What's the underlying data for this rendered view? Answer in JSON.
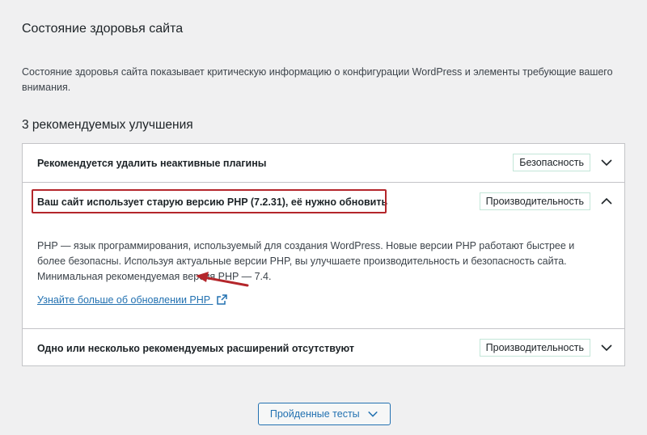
{
  "page": {
    "title": "Состояние здоровья сайта",
    "description": "Состояние здоровья сайта показывает критическую информацию о конфигурации WordPress и элементы требующие вашего внимания."
  },
  "recommendations": {
    "heading": "3 рекомендуемых улучшения",
    "items": [
      {
        "title": "Рекомендуется удалить неактивные плагины",
        "badge": "Безопасность",
        "expanded": false
      },
      {
        "title": "Ваш сайт использует старую версию PHP (7.2.31), её нужно обновить",
        "badge": "Производительность",
        "expanded": true,
        "body": "PHP — язык программирования, используемый для создания WordPress. Новые версии PHP работают быстрее и более безопасны. Используя актуальные версии PHP, вы улучшаете производительность и безопасность сайта. Минимальная рекомендуемая версия PHP — 7.4.",
        "link": "Узнайте больше об обновлении PHP"
      },
      {
        "title": "Одно или несколько рекомендуемых расширений отсутствуют",
        "badge": "Производительность",
        "expanded": false
      }
    ]
  },
  "passed_tests_button": "Пройденные тесты",
  "colors": {
    "background": "#f0f0f1",
    "link": "#2271b1",
    "highlight": "#b4262b",
    "badge_border": "#c3e6d8"
  },
  "icons": [
    "chevron-down-icon",
    "chevron-up-icon",
    "external-link-icon",
    "annotation-arrow-icon"
  ]
}
